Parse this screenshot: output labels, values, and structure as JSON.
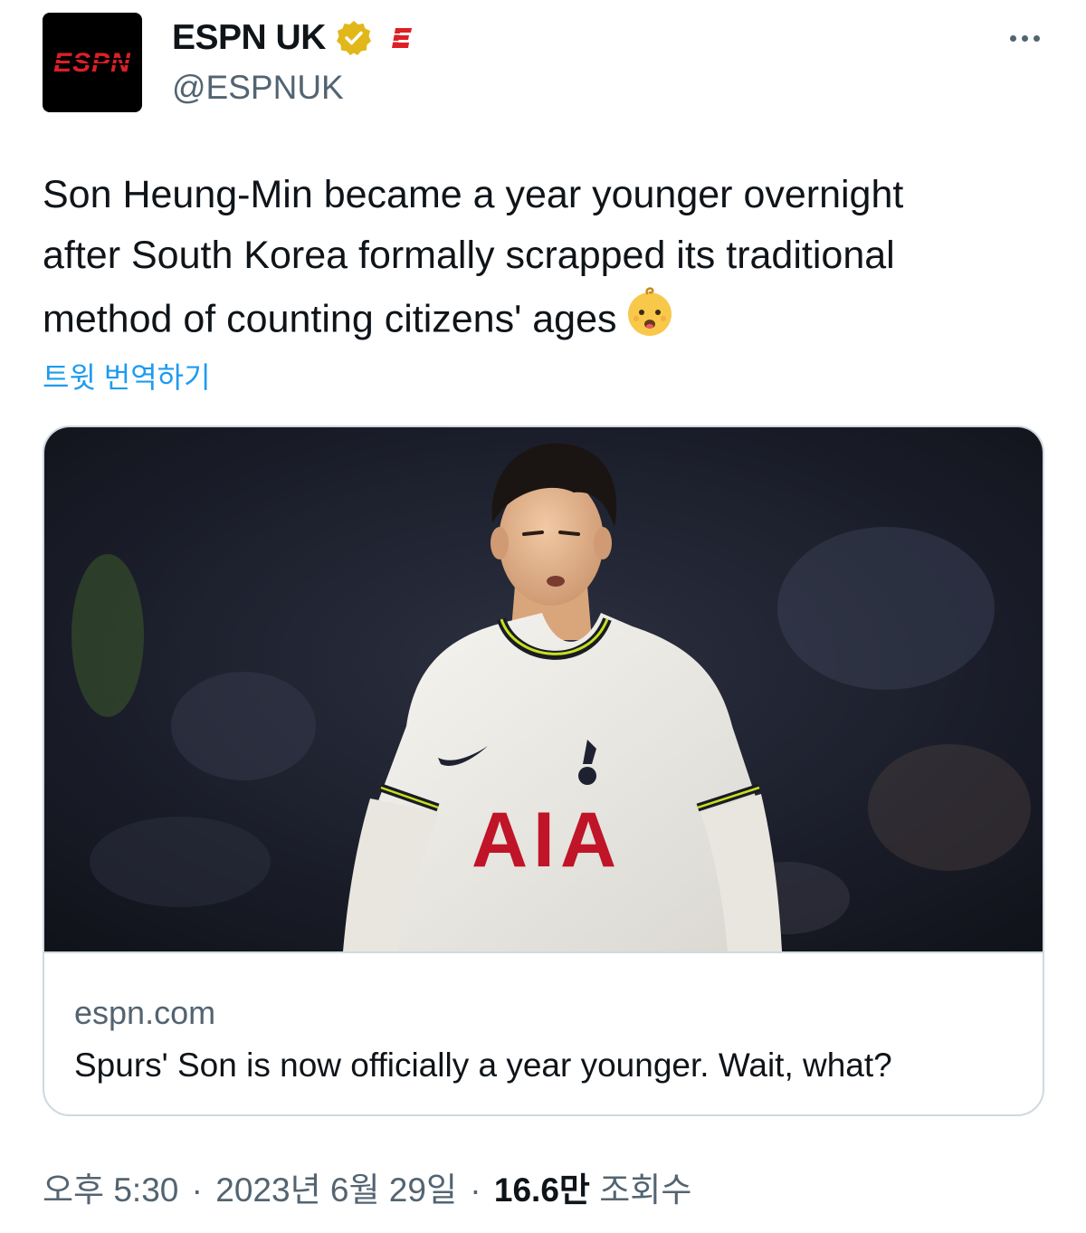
{
  "account": {
    "display_name": "ESPN UK",
    "handle": "@ESPNUK",
    "avatar_text": "ESPN",
    "verified_icon": "verified-badge-icon",
    "affiliate_icon": "espn-affiliate-icon"
  },
  "tweet": {
    "text_lines": [
      "Son Heung-Min became a year younger overnight",
      "after South Korea formally scrapped its traditional",
      "method of counting citizens' ages"
    ],
    "emoji": "baby-face-emoji",
    "translate_label": "트윗 번역하기"
  },
  "link_card": {
    "domain": "espn.com",
    "title": "Spurs' Son is now officially a year younger. Wait, what?",
    "photo_sponsor_text": "AIA"
  },
  "meta": {
    "time": "오후 5:30",
    "separator": "·",
    "date": "2023년 6월 29일",
    "views_count": "16.6만",
    "views_label": "조회수"
  },
  "colors": {
    "link_blue": "#1d9bf0",
    "secondary_text": "#536471",
    "primary_text": "#0f1419",
    "espn_red": "#d00",
    "verified_gold": "#e2b719",
    "card_border": "#cfd9de"
  }
}
